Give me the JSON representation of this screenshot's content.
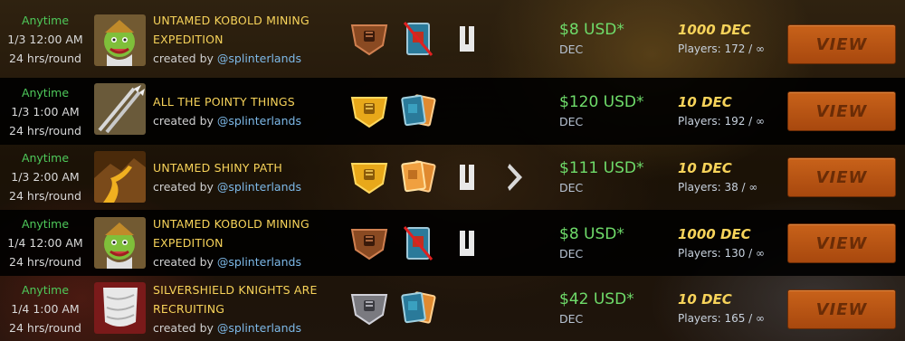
{
  "tournaments": [
    {
      "time": {
        "status": "Anytime",
        "start": "1/3 12:00 AM",
        "round": "24 hrs/round"
      },
      "title_line1": "UNTAMED KOBOLD MINING",
      "title_line2": "EXPEDITION",
      "created_by": "created by",
      "creator": "@splinterlands",
      "thumbnail": "kobold-miner",
      "rules": [
        "bronze-league-shield-icon",
        "no-gold-cards-icon",
        "untamed-edition-icon"
      ],
      "prize": "$8 USD*",
      "prize_currency": "DEC",
      "entry_fee": "1000 DEC",
      "players": "Players: 172 / ∞",
      "view_label": "VIEW"
    },
    {
      "time": {
        "status": "Anytime",
        "start": "1/3 1:00 AM",
        "round": "24 hrs/round"
      },
      "title_line1": "ALL THE POINTY THINGS",
      "title_line2": "",
      "created_by": "created by",
      "creator": "@splinterlands",
      "thumbnail": "crossed-spears",
      "rules": [
        "gold-league-shield-icon",
        "all-cards-icon"
      ],
      "prize": "$120 USD*",
      "prize_currency": "DEC",
      "entry_fee": "10 DEC",
      "players": "Players: 192 / ∞",
      "view_label": "VIEW"
    },
    {
      "time": {
        "status": "Anytime",
        "start": "1/3 2:00 AM",
        "round": "24 hrs/round"
      },
      "title_line1": "UNTAMED SHINY PATH",
      "title_line2": "",
      "created_by": "created by",
      "creator": "@splinterlands",
      "thumbnail": "golden-path",
      "rules": [
        "gold-league-shield-icon",
        "gold-cards-icon",
        "untamed-edition-icon",
        "chevron-right-icon"
      ],
      "prize": "$111 USD*",
      "prize_currency": "DEC",
      "entry_fee": "10 DEC",
      "players": "Players: 38 / ∞",
      "view_label": "VIEW"
    },
    {
      "time": {
        "status": "Anytime",
        "start": "1/4 12:00 AM",
        "round": "24 hrs/round"
      },
      "title_line1": "UNTAMED KOBOLD MINING",
      "title_line2": "EXPEDITION",
      "created_by": "created by",
      "creator": "@splinterlands",
      "thumbnail": "kobold-miner",
      "rules": [
        "bronze-league-shield-icon",
        "no-gold-cards-icon",
        "untamed-edition-icon"
      ],
      "prize": "$8 USD*",
      "prize_currency": "DEC",
      "entry_fee": "1000 DEC",
      "players": "Players: 130 / ∞",
      "view_label": "VIEW"
    },
    {
      "time": {
        "status": "Anytime",
        "start": "1/4 1:00 AM",
        "round": "24 hrs/round"
      },
      "title_line1": "SILVERSHIELD KNIGHTS ARE",
      "title_line2": "RECRUITING",
      "created_by": "created by",
      "creator": "@splinterlands",
      "thumbnail": "silver-banner",
      "rules": [
        "silver-league-shield-icon",
        "all-cards-icon"
      ],
      "prize": "$42 USD*",
      "prize_currency": "DEC",
      "entry_fee": "10 DEC",
      "players": "Players: 165 / ∞",
      "view_label": "VIEW"
    }
  ],
  "colors": {
    "anytime": "#4ec95a",
    "title": "#f7d35a",
    "prize": "#6fdc6a",
    "button": "#c8621a"
  }
}
